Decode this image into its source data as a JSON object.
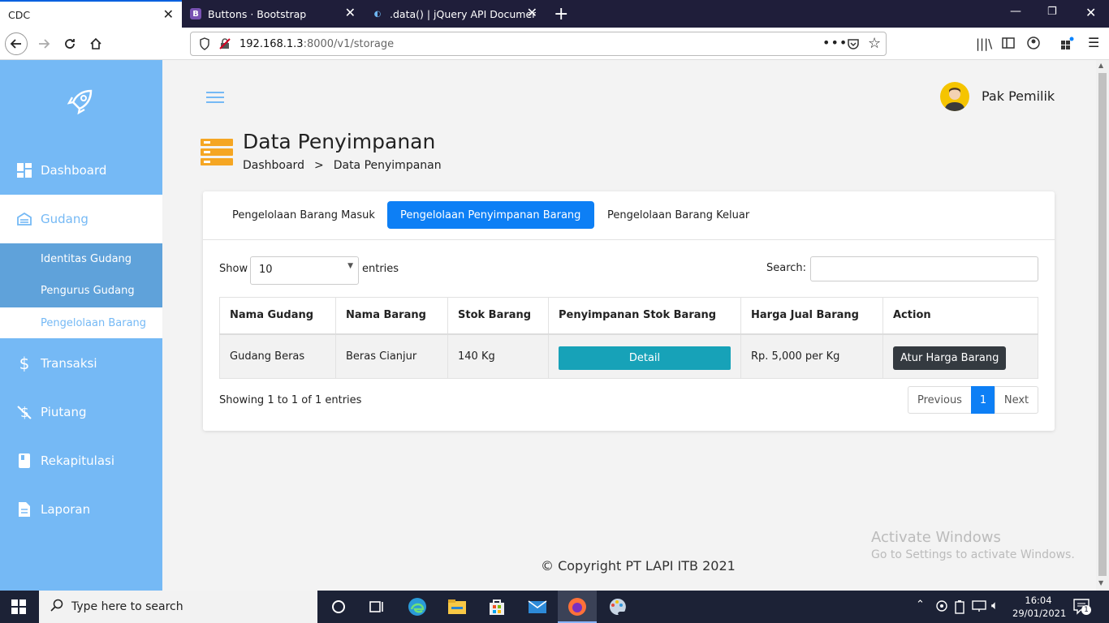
{
  "browser": {
    "tabs": [
      {
        "label": "CDC",
        "favicon": "none"
      },
      {
        "label": "Buttons · Bootstrap",
        "favicon": "bootstrap-icon"
      },
      {
        "label": ".data() | jQuery API Documenta",
        "favicon": "jquery-icon"
      }
    ],
    "url_host": "192.168.1.3",
    "url_path": ":8000/v1/storage"
  },
  "app": {
    "user_name": "Pak Pemilik",
    "page_title": "Data Penyimpanan",
    "breadcrumb": [
      "Dashboard",
      ">",
      "Data Penyimpanan"
    ],
    "footer": "© Copyright PT LAPI ITB 2021"
  },
  "sidebar": {
    "items": [
      {
        "label": "Dashboard",
        "icon": "dashboard-icon"
      },
      {
        "label": "Gudang",
        "icon": "warehouse-icon"
      },
      {
        "label": "Transaksi",
        "icon": "dollar-icon"
      },
      {
        "label": "Piutang",
        "icon": "no-dollar-icon"
      },
      {
        "label": "Rekapitulasi",
        "icon": "book-icon"
      },
      {
        "label": "Laporan",
        "icon": "file-icon"
      }
    ],
    "subitems": [
      "Identitas Gudang",
      "Pengurus Gudang",
      "Pengelolaan Barang"
    ]
  },
  "tabs": [
    "Pengelolaan Barang Masuk",
    "Pengelolaan Penyimpanan Barang",
    "Pengelolaan Barang Keluar"
  ],
  "table": {
    "show_label": "Show",
    "entries_value": "10",
    "entries_label": "entries",
    "search_label": "Search:",
    "search_value": "",
    "columns": [
      "Nama Gudang",
      "Nama Barang",
      "Stok Barang",
      "Penyimpanan Stok Barang",
      "Harga Jual Barang",
      "Action"
    ],
    "rows": [
      {
        "gudang": "Gudang Beras",
        "barang": "Beras Cianjur",
        "stok": "140 Kg",
        "detail": "Detail",
        "harga": "Rp. 5,000 per Kg",
        "action": "Atur Harga Barang"
      }
    ],
    "info": "Showing 1 to 1 of 1 entries",
    "pagination": {
      "prev": "Previous",
      "page": "1",
      "next": "Next"
    }
  },
  "watermark": {
    "line1": "Activate Windows",
    "line2": "Go to Settings to activate Windows."
  },
  "taskbar": {
    "search_placeholder": "Type here to search",
    "time": "16:04",
    "date": "29/01/2021",
    "notifications": "1"
  },
  "colors": {
    "sidebar": "#75b9f5",
    "primary": "#0d7ff5",
    "detail": "#17a2b8",
    "dark": "#343a40",
    "title_icon": "#f5a623"
  }
}
